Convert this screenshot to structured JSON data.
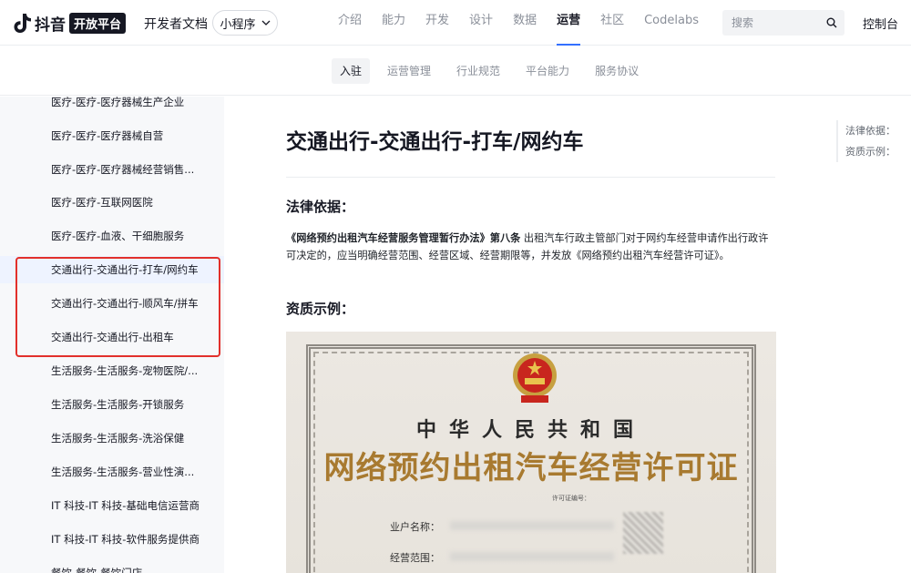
{
  "header": {
    "brand_word": "抖音",
    "brand_badge": "开放平台",
    "doc_title": "开发者文档",
    "product_select": "小程序",
    "nav": [
      "介绍",
      "能力",
      "开发",
      "设计",
      "数据",
      "运营",
      "社区",
      "Codelabs"
    ],
    "nav_active_index": 5,
    "search_placeholder": "搜索",
    "console": "控制台"
  },
  "subnav": {
    "items": [
      "入驻",
      "运营管理",
      "行业规范",
      "平台能力",
      "服务协议"
    ],
    "active_index": 0
  },
  "sidebar": {
    "items": [
      "医疗-医疗-医疗器械生产企业",
      "医疗-医疗-医疗器械自营",
      "医疗-医疗-医疗器械经营销售...",
      "医疗-医疗-互联网医院",
      "医疗-医疗-血液、干细胞服务",
      "交通出行-交通出行-打车/网约车",
      "交通出行-交通出行-顺风车/拼车",
      "交通出行-交通出行-出租车",
      "生活服务-生活服务-宠物医院/...",
      "生活服务-生活服务-开锁服务",
      "生活服务-生活服务-洗浴保健",
      "生活服务-生活服务-营业性演...",
      "IT 科技-IT 科技-基础电信运营商",
      "IT 科技-IT 科技-软件服务提供商",
      "餐饮-餐饮-餐饮门店"
    ],
    "active_index": 5
  },
  "article": {
    "title": "交通出行-交通出行-打车/网约车",
    "legal_heading": "法律依据：",
    "legal_ref": "《网络预约出租汽车经营服务管理暂行办法》第八条",
    "legal_text": " 出租汽车行政主管部门对于网约车经营申请作出行政许可决定的，应当明确经营范围、经营区域、经营期限等，并发放《网络预约出租汽车经营许可证》。",
    "example_heading": "资质示例："
  },
  "certificate": {
    "country": "中华人民共和国",
    "name": "网络预约出租汽车经营许可证",
    "license_no_label": "许可证编号：",
    "holder_label": "业户名称：",
    "scope_label": "经营范围："
  },
  "toc": {
    "items": [
      "法律依据：",
      "资质示例："
    ]
  },
  "colors": {
    "accent": "#3370ff",
    "highlight": "#e2302b",
    "cert_gold": "#a87a30"
  }
}
